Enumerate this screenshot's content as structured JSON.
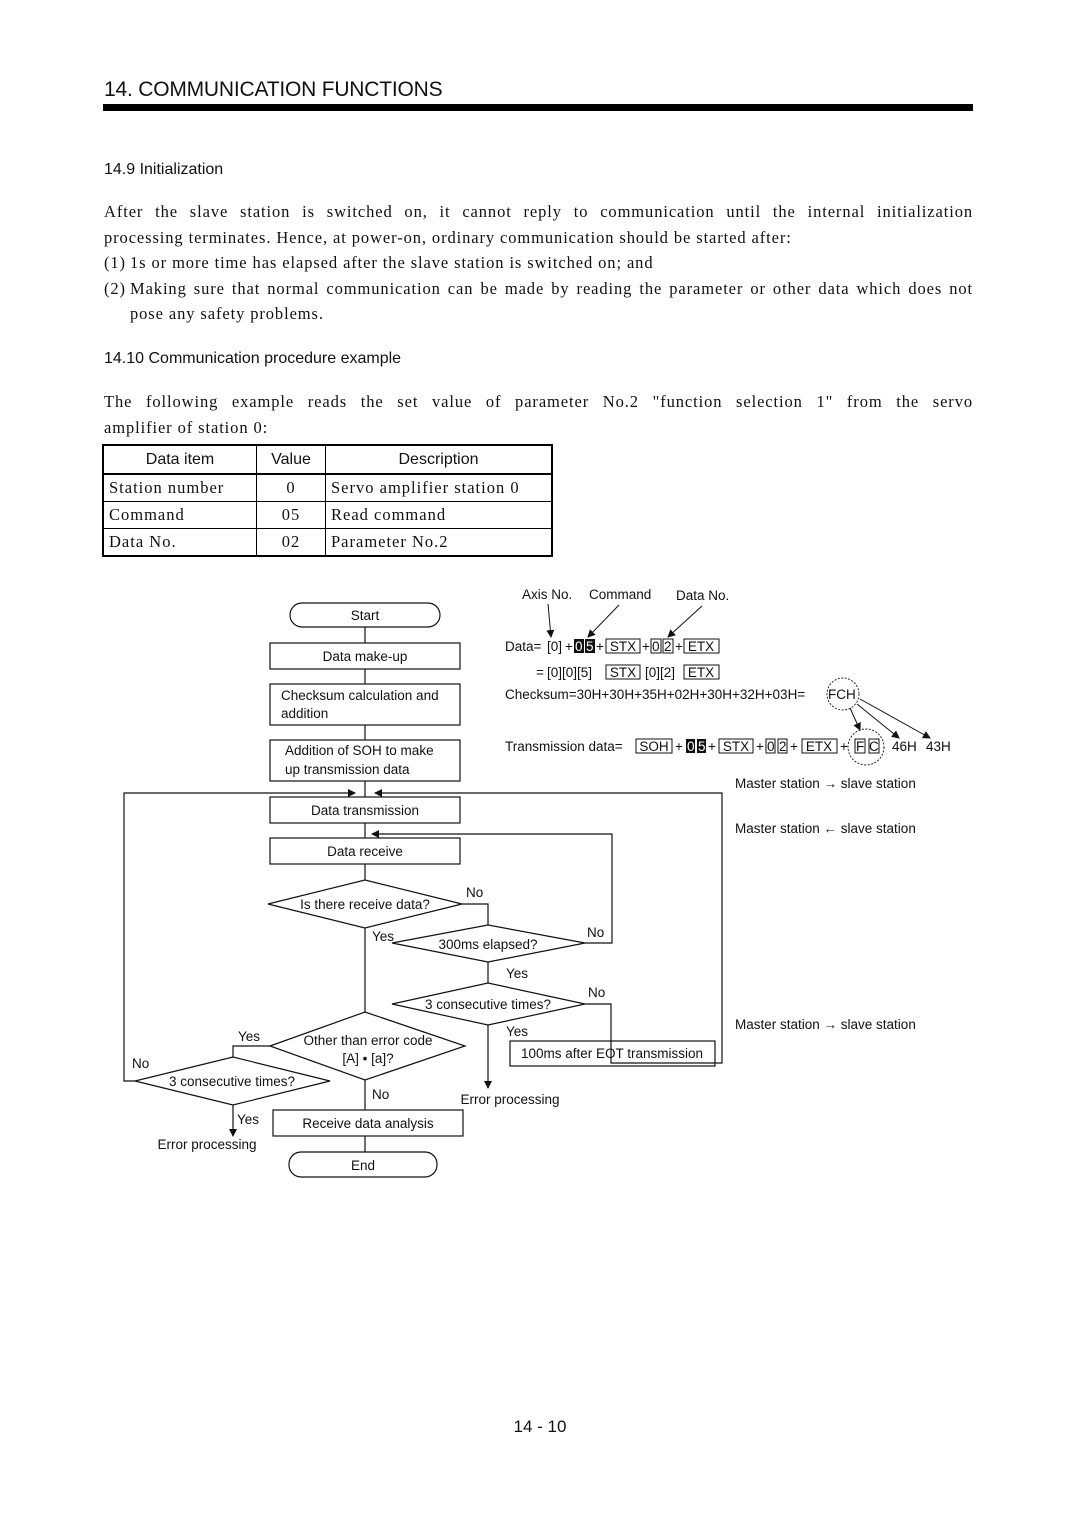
{
  "header": {
    "chapter_title": "14. COMMUNICATION FUNCTIONS"
  },
  "section_initialization": {
    "title": "14.9 Initialization",
    "intro_line1": "After the slave station is switched on, it cannot reply to communication until the internal initialization",
    "intro_line2": "processing terminates. Hence, at power-on, ordinary communication should be started after:",
    "items": [
      {
        "num": "(1)",
        "text": "1s or more time has elapsed after the slave station is switched on; and"
      },
      {
        "num": "(2)",
        "text": "Making sure that normal communication can be made by reading the parameter or other data which does not pose any safety problems."
      }
    ]
  },
  "section_procedure": {
    "title": "14.10 Communication procedure example",
    "intro_line1": "The following example reads the set value of parameter No.2 \"function selection 1\" from the servo",
    "intro_line2": "amplifier of station 0:",
    "table": {
      "headers": [
        "Data item",
        "Value",
        "Description"
      ],
      "rows": [
        [
          "Station number",
          "0",
          "Servo amplifier station 0"
        ],
        [
          "Command",
          "05",
          "Read command"
        ],
        [
          "Data No.",
          "02",
          "Parameter No.2"
        ]
      ]
    }
  },
  "data_diagram": {
    "labels": {
      "axis_no": "Axis No.",
      "command": "Command",
      "data_no": "Data No."
    },
    "data_prefix": "Data=",
    "data_axis": "[0]",
    "cmd_digits": [
      "0",
      "5"
    ],
    "stx": "STX",
    "etx": "ETX",
    "soh": "SOH",
    "data_digits": [
      "0",
      "2"
    ],
    "plus": "+",
    "expanded_prefix": "=",
    "expanded_axis_cmd": "[0][0][5]",
    "expanded_data": "[0][2]",
    "checksum": "Checksum=30H+30H+35H+02H+30H+32H+03H=",
    "checksum_value": "FCH",
    "transmission_prefix": "Transmission data=",
    "checksum_digits": [
      "F",
      "C"
    ],
    "hex_values": [
      "46H",
      "43H"
    ]
  },
  "direction_notes": [
    "Master station → slave station",
    "Master station ← slave station",
    "Master station → slave station"
  ],
  "flowchart": {
    "start": "Start",
    "data_makeup": "Data make-up",
    "checksum_line1": "Checksum calculation and",
    "checksum_line2": "addition",
    "soh_line1": "Addition of SOH to make",
    "soh_line2": "up transmission data",
    "data_transmission": "Data transmission",
    "data_receive": "Data receive",
    "q_receive_data": "Is there receive data?",
    "q_300ms": "300ms elapsed?",
    "q_3times_right": "3 consecutive times?",
    "eot_box": "100ms after EOT transmission",
    "q_error_code_line1": "Other than error code",
    "q_error_code_line2": "[A] • [a]?",
    "q_3times_left": "3 consecutive times?",
    "receive_analysis": "Receive data analysis",
    "end": "End",
    "error_processing": "Error processing",
    "yes": "Yes",
    "no": "No"
  },
  "footer": {
    "page_number": "14 -  10"
  }
}
